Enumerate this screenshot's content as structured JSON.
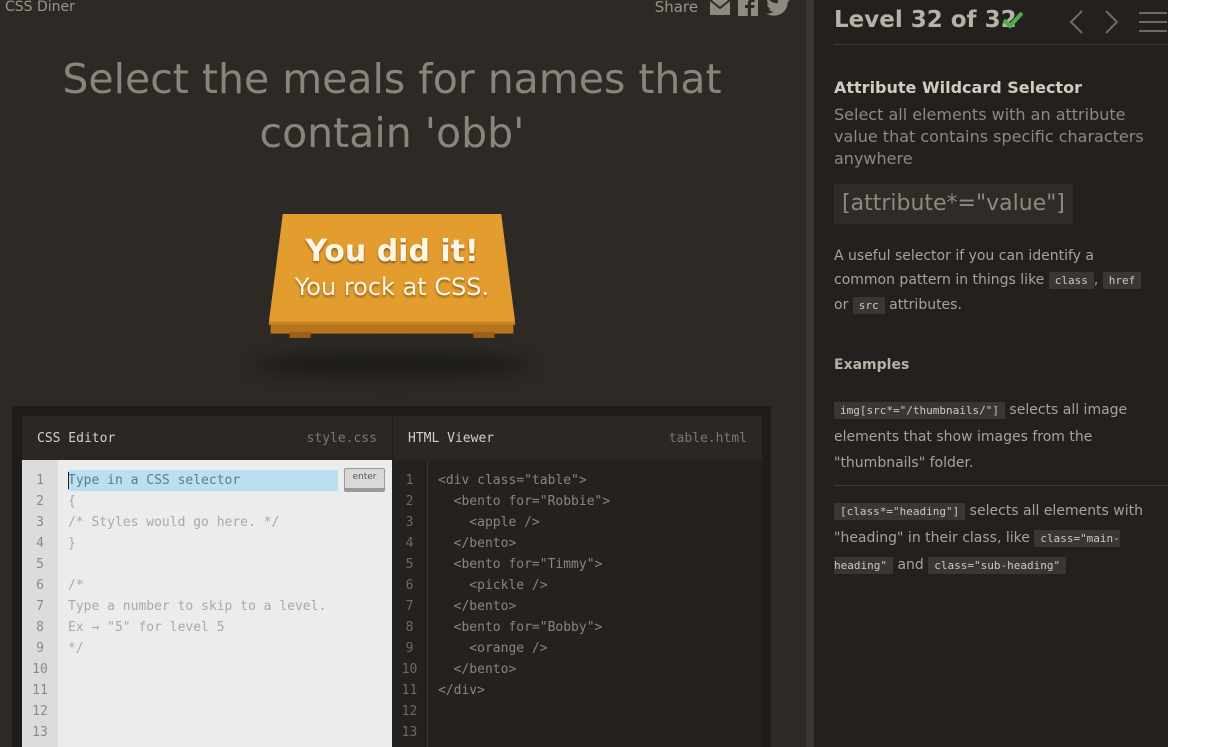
{
  "app": {
    "brand": "CSS Diner",
    "share_label": "Share"
  },
  "game": {
    "instruction": "Select the meals for names that contain 'obb'",
    "win_title": "You did it!",
    "win_subtitle": "You rock at CSS."
  },
  "css_editor": {
    "title": "CSS Editor",
    "filename": "style.css",
    "input_placeholder": "Type in a CSS selector",
    "input_value": "",
    "enter_label": "enter",
    "line_numbers": [
      "1",
      "2",
      "3",
      "4",
      "5",
      "6",
      "7",
      "8",
      "9",
      "10",
      "11",
      "12",
      "13"
    ],
    "lines": [
      "",
      "{",
      "/* Styles would go here. */",
      "}",
      "",
      "/*",
      "Type a number to skip to a level.",
      "Ex → \"5\" for level 5",
      "*/",
      "",
      "",
      "",
      ""
    ]
  },
  "html_viewer": {
    "title": "HTML Viewer",
    "filename": "table.html",
    "line_numbers": [
      "1",
      "2",
      "3",
      "4",
      "5",
      "6",
      "7",
      "8",
      "9",
      "10",
      "11",
      "12",
      "13"
    ],
    "lines": [
      "<div class=\"table\">",
      "  <bento for=\"Robbie\">",
      "    <apple />",
      "  </bento>",
      "  <bento for=\"Timmy\">",
      "    <pickle />",
      "  </bento>",
      "  <bento for=\"Bobby\">",
      "    <orange />",
      "  </bento>",
      "</div>",
      "",
      ""
    ]
  },
  "sidebar": {
    "level_title": "Level 32 of 32",
    "selector_name": "Attribute Wildcard Selector",
    "selector_desc": "Select all elements with an attribute value that contains specific characters anywhere",
    "syntax": "[attribute*=\"value\"]",
    "hint_before": "A useful selector if you can identify a common pattern in things like",
    "hint_code1": "class",
    "hint_sep1": ",",
    "hint_code2": "href",
    "hint_sep2": "or",
    "hint_code3": "src",
    "hint_after": "attributes.",
    "examples_label": "Examples",
    "ex1_code": "img[src*=\"/thumbnails/\"]",
    "ex1_text": "selects all image elements that show images from the \"thumbnails\" folder.",
    "ex2_code": "[class*=\"heading\"]",
    "ex2_text": "selects all elements with \"heading\" in their class, like",
    "ex2_code2": "class=\"main-heading\"",
    "ex2_and": "and",
    "ex2_code3": "class=\"sub-heading\""
  },
  "colors": {
    "accent_check": "#4cae4c",
    "table": "#e09a2c",
    "game_bg": "#2d2a26",
    "sidebar_bg": "#23201d"
  }
}
